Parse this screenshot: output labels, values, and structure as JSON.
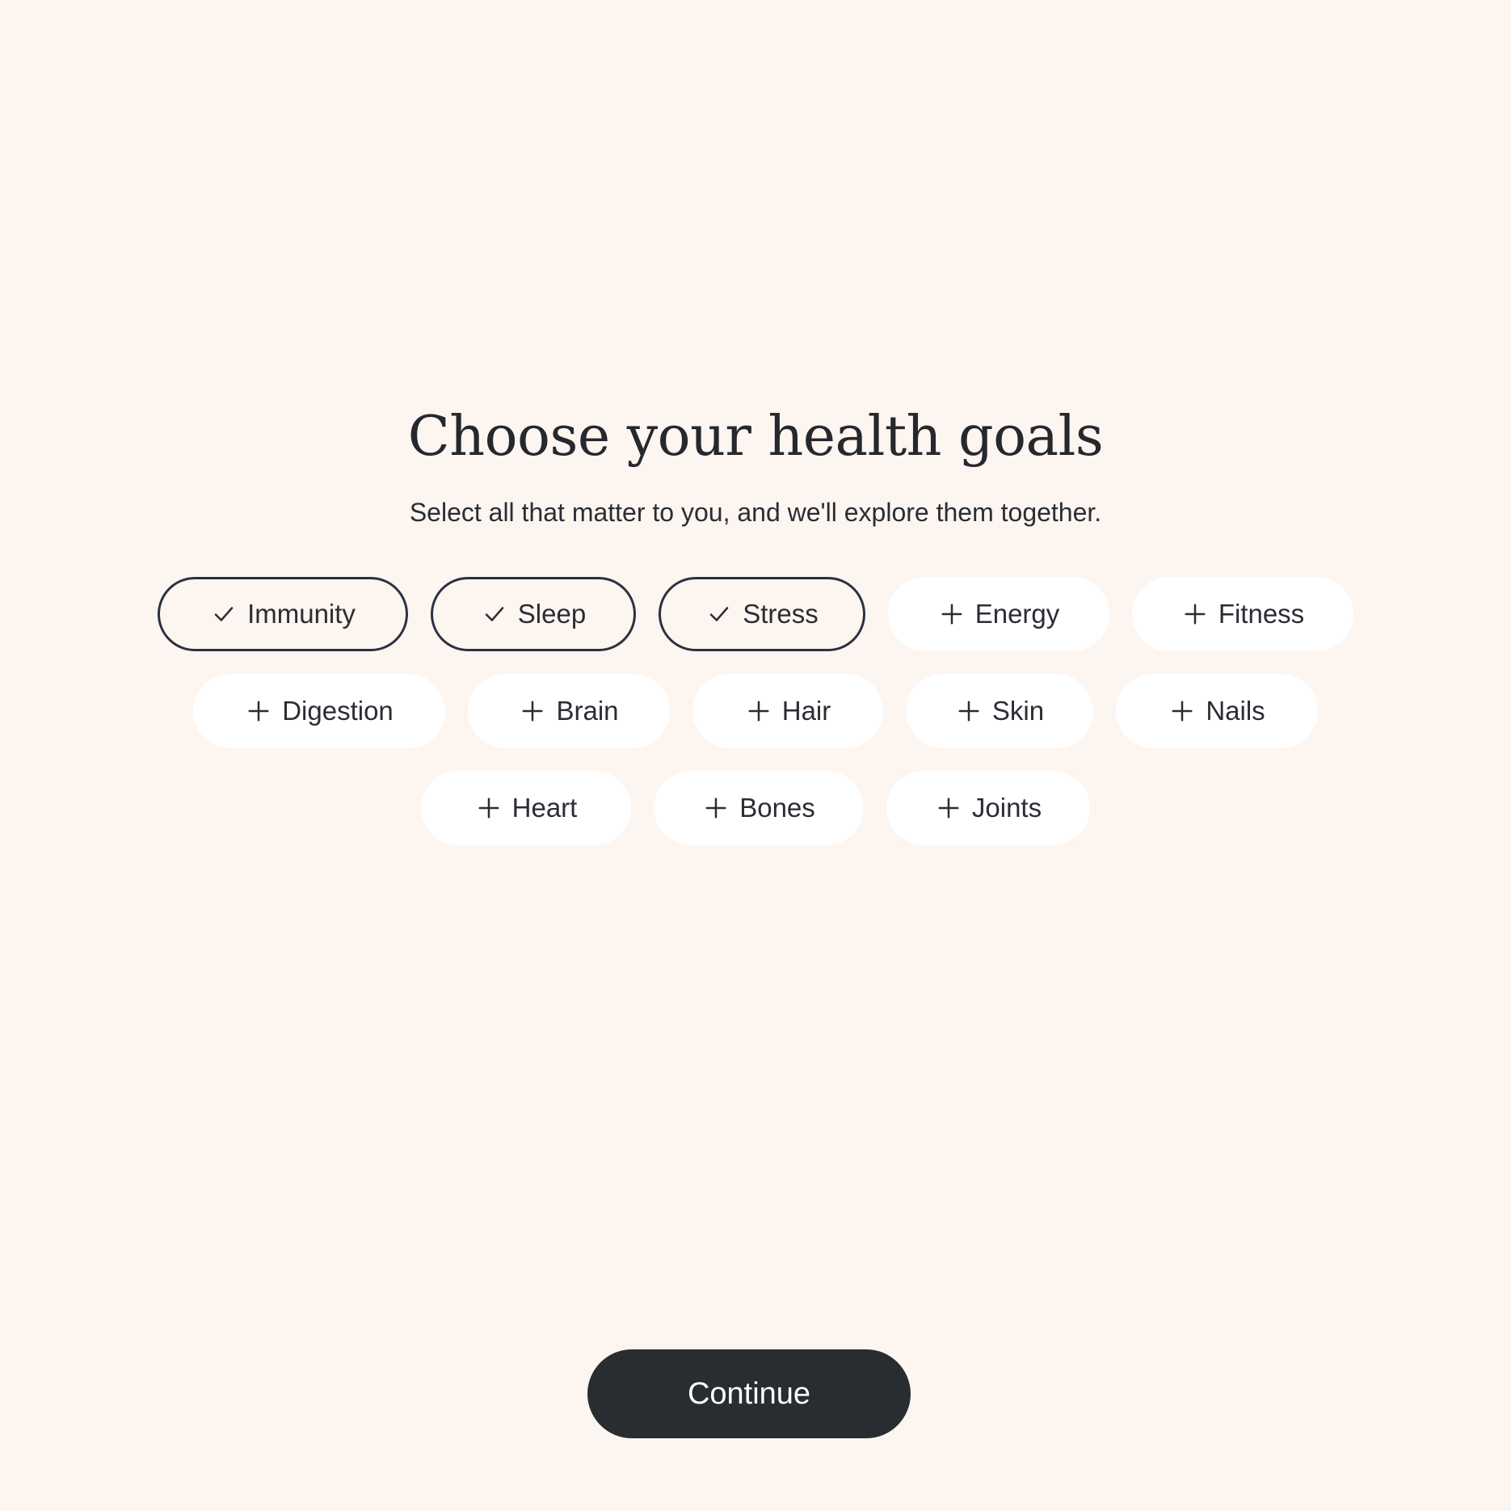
{
  "header": {
    "title": "Choose your health goals",
    "subtitle": "Select all that matter to you, and we'll explore them together."
  },
  "goals": {
    "rows": [
      [
        {
          "label": "Immunity",
          "selected": true,
          "icon": "check-icon"
        },
        {
          "label": "Sleep",
          "selected": true,
          "icon": "check-icon"
        },
        {
          "label": "Stress",
          "selected": true,
          "icon": "check-icon"
        },
        {
          "label": "Energy",
          "selected": false,
          "icon": "plus-icon"
        },
        {
          "label": "Fitness",
          "selected": false,
          "icon": "plus-icon"
        }
      ],
      [
        {
          "label": "Digestion",
          "selected": false,
          "icon": "plus-icon"
        },
        {
          "label": "Brain",
          "selected": false,
          "icon": "plus-icon"
        },
        {
          "label": "Hair",
          "selected": false,
          "icon": "plus-icon"
        },
        {
          "label": "Skin",
          "selected": false,
          "icon": "plus-icon"
        },
        {
          "label": "Nails",
          "selected": false,
          "icon": "plus-icon"
        }
      ],
      [
        {
          "label": "Heart",
          "selected": false,
          "icon": "plus-icon"
        },
        {
          "label": "Bones",
          "selected": false,
          "icon": "plus-icon"
        },
        {
          "label": "Joints",
          "selected": false,
          "icon": "plus-icon"
        }
      ]
    ]
  },
  "footer": {
    "continue_label": "Continue"
  },
  "colors": {
    "background": "#fdf5f0",
    "chip_background": "#ffffff",
    "selected_border": "#2c3140",
    "button_background": "#292c30",
    "text": "#2a2d33"
  }
}
